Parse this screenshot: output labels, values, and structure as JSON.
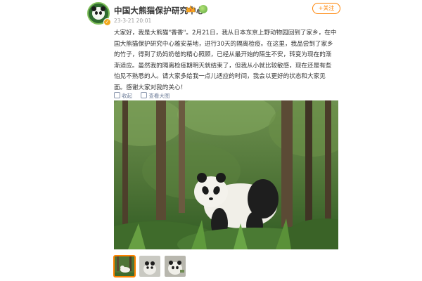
{
  "post": {
    "account_name": "中国大熊猫保护研究中心",
    "meta": "23-3-21 20:01",
    "follow_label": "+关注",
    "lines": [
      "大家好，我是大熊猫\"香香\"。2月21日，我从日本东京上野动物园回到了家乡，在中",
      "国大熊猫保护研究中心雅安基地，进行30天的隔离检疫。在这里，我品尝到了家乡",
      "的竹子，得到了奶妈奶爸的精心照顾，已经从最开始的陌生不安，转变为现在的渐",
      "渐适应。虽然我的隔离检疫期明天就结束了，但我从小就比较敏感，现在还是有些",
      "怕见不熟悉的人。请大家多给我一点儿适应的时间，我会以更好的状态和大家见",
      "面。感谢大家对我的关心！"
    ]
  },
  "actions": {
    "collapse": "收起",
    "view_large": "查看大图"
  },
  "icons": [
    "verified-badge-icon",
    "crown-badge-icon",
    "green-dot-badge-icon",
    "collapse-icon",
    "view-large-icon"
  ],
  "colors": {
    "accent": "#ff8200",
    "link": "#6e7d99"
  },
  "thumbnails": [
    {
      "selected": true
    },
    {
      "selected": false
    },
    {
      "selected": false
    }
  ]
}
